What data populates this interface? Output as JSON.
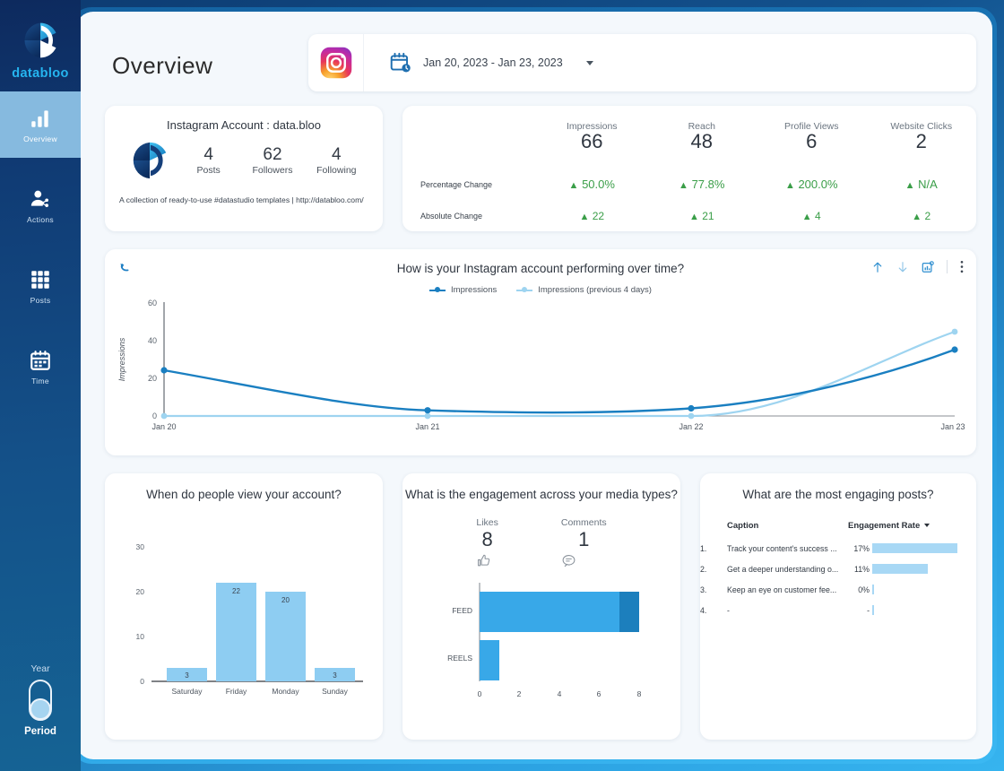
{
  "sidebar": {
    "brand": "databloo",
    "items": [
      {
        "label": "Overview",
        "icon": "bar-chart-icon",
        "active": true
      },
      {
        "label": "Actions",
        "icon": "user-share-icon",
        "active": false
      },
      {
        "label": "Posts",
        "icon": "grid-icon",
        "active": false
      },
      {
        "label": "Time",
        "icon": "calendar-icon",
        "active": false
      }
    ],
    "switch": {
      "top_label": "Year",
      "bottom_label": "Period",
      "selected": "Period"
    }
  },
  "header": {
    "title": "Overview",
    "platform_icon": "instagram-icon",
    "calendar_icon": "calendar-clock-icon",
    "date_range": "Jan 20, 2023 - Jan 23, 2023",
    "dropdown_icon": "chevron-down-icon"
  },
  "account_card": {
    "heading": "Instagram Account : data.bloo",
    "avatar_icon": "databloo-logo-icon",
    "stats": [
      {
        "value": "4",
        "label": "Posts"
      },
      {
        "value": "62",
        "label": "Followers"
      },
      {
        "value": "4",
        "label": "Following"
      }
    ],
    "bio": "A collection of ready-to-use #datastudio templates | http://databloo.com/"
  },
  "metrics_card": {
    "row_labels": [
      "Percentage Change",
      "Absolute Change"
    ],
    "columns": [
      {
        "name": "Impressions",
        "value": "66",
        "pct_change": "50.0%",
        "abs_change": "22"
      },
      {
        "name": "Reach",
        "value": "48",
        "pct_change": "77.8%",
        "abs_change": "21"
      },
      {
        "name": "Profile Views",
        "value": "6",
        "pct_change": "200.0%",
        "abs_change": "4"
      },
      {
        "name": "Website Clicks",
        "value": "2",
        "pct_change": "N/A",
        "abs_change": "2"
      }
    ],
    "change_color": "#3a9e48",
    "up_arrow_glyph": "▲"
  },
  "line_card": {
    "title": "How is your Instagram account performing over time?",
    "undo_icon": "undo-icon",
    "tools": [
      "arrow-up-icon",
      "arrow-down-icon",
      "export-chart-icon",
      "more-vertical-icon"
    ]
  },
  "weekday_card": {
    "title": "When do people view your account?"
  },
  "media_card": {
    "title": "What is the engagement across your media types?",
    "kpis": [
      {
        "label": "Likes",
        "value": "8",
        "icon": "thumbs-up-icon"
      },
      {
        "label": "Comments",
        "value": "1",
        "icon": "comment-icon"
      }
    ]
  },
  "posts_card": {
    "title": "What are the most engaging posts?",
    "columns": [
      "Caption",
      "Engagement Rate"
    ],
    "sort_icon": "sort-desc-caret-icon",
    "rows": [
      {
        "rank": "1.",
        "caption": "Track your content's success ...",
        "rate_label": "17%",
        "rate_value": 17
      },
      {
        "rank": "2.",
        "caption": "Get a deeper understanding o...",
        "rate_label": "11%",
        "rate_value": 11
      },
      {
        "rank": "3.",
        "caption": "Keep an eye on customer fee...",
        "rate_label": "0%",
        "rate_value": 0
      },
      {
        "rank": "4.",
        "caption": "-",
        "rate_label": "-",
        "rate_value": 0
      }
    ],
    "bar_color": "#a8d8f5"
  },
  "chart_data": [
    {
      "id": "impressions_over_time",
      "type": "line",
      "title": "How is your Instagram account performing over time?",
      "xlabel": "",
      "ylabel": "Impressions",
      "x": [
        "Jan 20",
        "Jan 21",
        "Jan 22",
        "Jan 23"
      ],
      "yticks": [
        0,
        20,
        40,
        60
      ],
      "ylim": [
        0,
        60
      ],
      "grid": false,
      "legend_position": "top-center",
      "series": [
        {
          "name": "Impressions",
          "color": "#1a7fc1",
          "values": [
            24,
            3,
            4,
            35
          ]
        },
        {
          "name": "Impressions (previous 4 days)",
          "color": "#9ed4f0",
          "values": [
            0,
            0,
            0,
            44
          ]
        }
      ]
    },
    {
      "id": "views_by_weekday",
      "type": "bar",
      "title": "When do people view your account?",
      "categories": [
        "Saturday",
        "Friday",
        "Monday",
        "Sunday"
      ],
      "values": [
        3,
        22,
        20,
        3
      ],
      "data_labels": [
        "3",
        "22",
        "20",
        "3"
      ],
      "yticks": [
        0,
        10,
        20,
        30
      ],
      "ylim": [
        0,
        33
      ],
      "xlabel": "",
      "ylabel": "",
      "grid": false,
      "bar_color": "#8ecdf2"
    },
    {
      "id": "engagement_by_media_type",
      "type": "bar",
      "orientation": "horizontal",
      "stacked": true,
      "title": "What is the engagement across your media types?",
      "categories": [
        "FEED",
        "REELS"
      ],
      "xticks": [
        0,
        2,
        4,
        6,
        8
      ],
      "xlim": [
        0,
        8
      ],
      "grid": false,
      "series": [
        {
          "name": "Likes",
          "color": "#38a8e8",
          "values": [
            7,
            1
          ]
        },
        {
          "name": "Comments",
          "color": "#1c7fbd",
          "values": [
            1,
            0
          ]
        }
      ]
    },
    {
      "id": "most_engaging_posts",
      "type": "table",
      "title": "What are the most engaging posts?",
      "columns": [
        "Caption",
        "Engagement Rate"
      ],
      "rows": [
        [
          "Track your content's success ...",
          "17%"
        ],
        [
          "Get a deeper understanding o...",
          "11%"
        ],
        [
          "Keep an eye on customer fee...",
          "0%"
        ],
        [
          "-",
          "-"
        ]
      ]
    }
  ]
}
